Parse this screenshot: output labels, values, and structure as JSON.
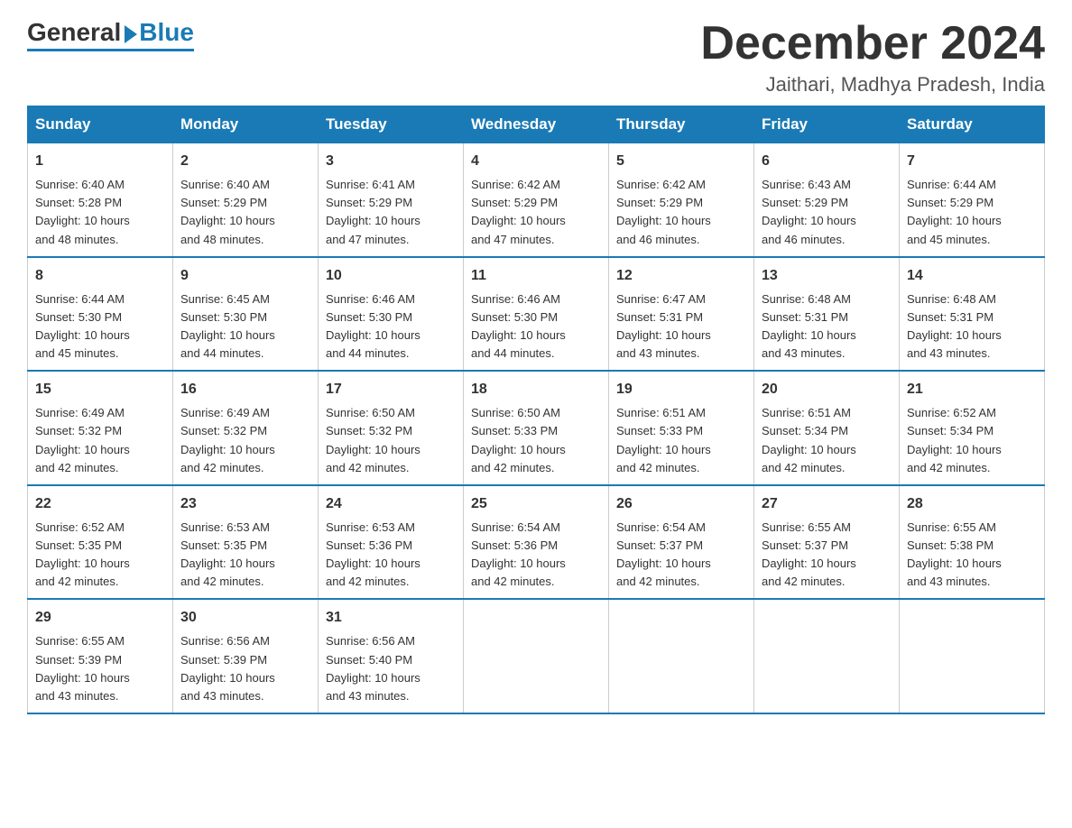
{
  "header": {
    "logo_general": "General",
    "logo_blue": "Blue",
    "month_title": "December 2024",
    "location": "Jaithari, Madhya Pradesh, India"
  },
  "days_of_week": [
    "Sunday",
    "Monday",
    "Tuesday",
    "Wednesday",
    "Thursday",
    "Friday",
    "Saturday"
  ],
  "weeks": [
    [
      {
        "day": "1",
        "sunrise": "6:40 AM",
        "sunset": "5:28 PM",
        "daylight": "10 hours and 48 minutes."
      },
      {
        "day": "2",
        "sunrise": "6:40 AM",
        "sunset": "5:29 PM",
        "daylight": "10 hours and 48 minutes."
      },
      {
        "day": "3",
        "sunrise": "6:41 AM",
        "sunset": "5:29 PM",
        "daylight": "10 hours and 47 minutes."
      },
      {
        "day": "4",
        "sunrise": "6:42 AM",
        "sunset": "5:29 PM",
        "daylight": "10 hours and 47 minutes."
      },
      {
        "day": "5",
        "sunrise": "6:42 AM",
        "sunset": "5:29 PM",
        "daylight": "10 hours and 46 minutes."
      },
      {
        "day": "6",
        "sunrise": "6:43 AM",
        "sunset": "5:29 PM",
        "daylight": "10 hours and 46 minutes."
      },
      {
        "day": "7",
        "sunrise": "6:44 AM",
        "sunset": "5:29 PM",
        "daylight": "10 hours and 45 minutes."
      }
    ],
    [
      {
        "day": "8",
        "sunrise": "6:44 AM",
        "sunset": "5:30 PM",
        "daylight": "10 hours and 45 minutes."
      },
      {
        "day": "9",
        "sunrise": "6:45 AM",
        "sunset": "5:30 PM",
        "daylight": "10 hours and 44 minutes."
      },
      {
        "day": "10",
        "sunrise": "6:46 AM",
        "sunset": "5:30 PM",
        "daylight": "10 hours and 44 minutes."
      },
      {
        "day": "11",
        "sunrise": "6:46 AM",
        "sunset": "5:30 PM",
        "daylight": "10 hours and 44 minutes."
      },
      {
        "day": "12",
        "sunrise": "6:47 AM",
        "sunset": "5:31 PM",
        "daylight": "10 hours and 43 minutes."
      },
      {
        "day": "13",
        "sunrise": "6:48 AM",
        "sunset": "5:31 PM",
        "daylight": "10 hours and 43 minutes."
      },
      {
        "day": "14",
        "sunrise": "6:48 AM",
        "sunset": "5:31 PM",
        "daylight": "10 hours and 43 minutes."
      }
    ],
    [
      {
        "day": "15",
        "sunrise": "6:49 AM",
        "sunset": "5:32 PM",
        "daylight": "10 hours and 42 minutes."
      },
      {
        "day": "16",
        "sunrise": "6:49 AM",
        "sunset": "5:32 PM",
        "daylight": "10 hours and 42 minutes."
      },
      {
        "day": "17",
        "sunrise": "6:50 AM",
        "sunset": "5:32 PM",
        "daylight": "10 hours and 42 minutes."
      },
      {
        "day": "18",
        "sunrise": "6:50 AM",
        "sunset": "5:33 PM",
        "daylight": "10 hours and 42 minutes."
      },
      {
        "day": "19",
        "sunrise": "6:51 AM",
        "sunset": "5:33 PM",
        "daylight": "10 hours and 42 minutes."
      },
      {
        "day": "20",
        "sunrise": "6:51 AM",
        "sunset": "5:34 PM",
        "daylight": "10 hours and 42 minutes."
      },
      {
        "day": "21",
        "sunrise": "6:52 AM",
        "sunset": "5:34 PM",
        "daylight": "10 hours and 42 minutes."
      }
    ],
    [
      {
        "day": "22",
        "sunrise": "6:52 AM",
        "sunset": "5:35 PM",
        "daylight": "10 hours and 42 minutes."
      },
      {
        "day": "23",
        "sunrise": "6:53 AM",
        "sunset": "5:35 PM",
        "daylight": "10 hours and 42 minutes."
      },
      {
        "day": "24",
        "sunrise": "6:53 AM",
        "sunset": "5:36 PM",
        "daylight": "10 hours and 42 minutes."
      },
      {
        "day": "25",
        "sunrise": "6:54 AM",
        "sunset": "5:36 PM",
        "daylight": "10 hours and 42 minutes."
      },
      {
        "day": "26",
        "sunrise": "6:54 AM",
        "sunset": "5:37 PM",
        "daylight": "10 hours and 42 minutes."
      },
      {
        "day": "27",
        "sunrise": "6:55 AM",
        "sunset": "5:37 PM",
        "daylight": "10 hours and 42 minutes."
      },
      {
        "day": "28",
        "sunrise": "6:55 AM",
        "sunset": "5:38 PM",
        "daylight": "10 hours and 43 minutes."
      }
    ],
    [
      {
        "day": "29",
        "sunrise": "6:55 AM",
        "sunset": "5:39 PM",
        "daylight": "10 hours and 43 minutes."
      },
      {
        "day": "30",
        "sunrise": "6:56 AM",
        "sunset": "5:39 PM",
        "daylight": "10 hours and 43 minutes."
      },
      {
        "day": "31",
        "sunrise": "6:56 AM",
        "sunset": "5:40 PM",
        "daylight": "10 hours and 43 minutes."
      },
      null,
      null,
      null,
      null
    ]
  ],
  "labels": {
    "sunrise": "Sunrise:",
    "sunset": "Sunset:",
    "daylight": "Daylight:"
  }
}
